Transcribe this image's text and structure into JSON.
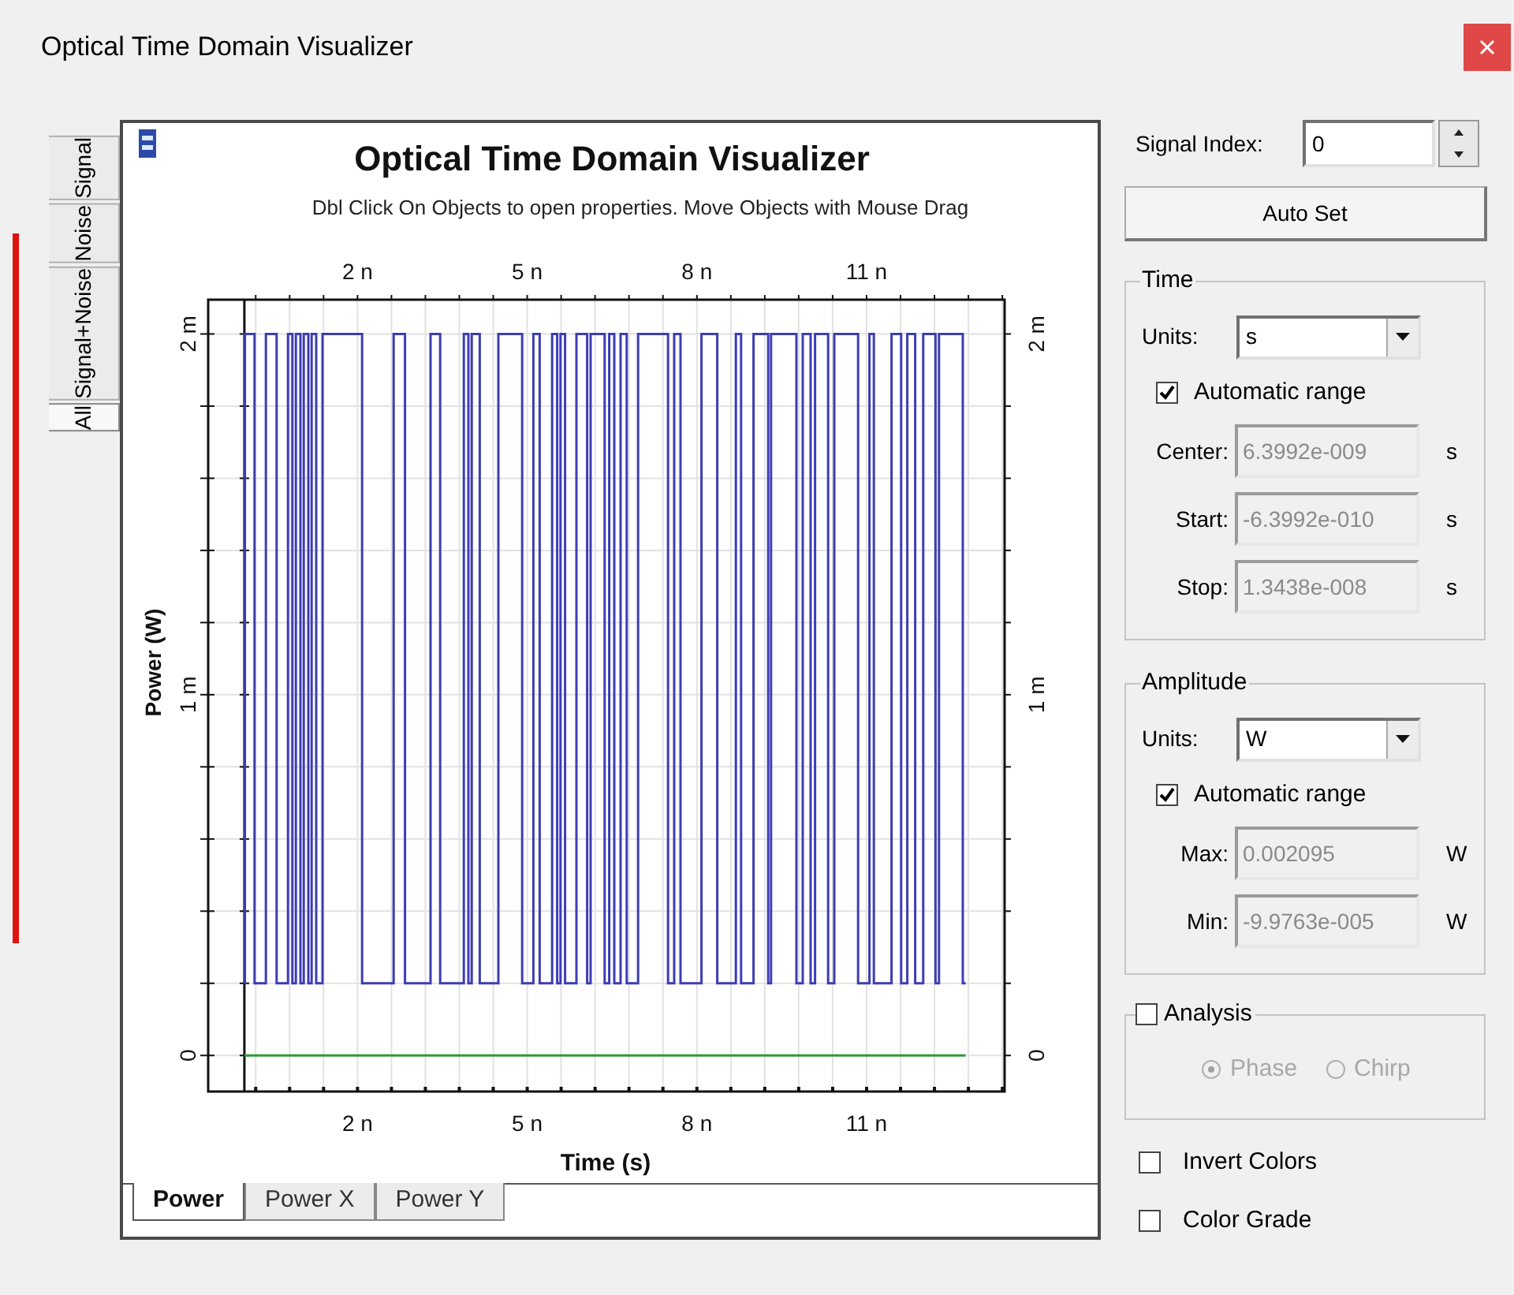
{
  "window": {
    "title": "Optical Time Domain Visualizer"
  },
  "side_tabs": [
    {
      "label": "Signal",
      "selected": false
    },
    {
      "label": "Noise",
      "selected": false
    },
    {
      "label": "Signal+Noise",
      "selected": false
    },
    {
      "label": "All",
      "selected": true
    }
  ],
  "plot": {
    "hint": "Dbl Click On Objects to open properties.  Move Objects with Mouse Drag",
    "top_xtick_labels": [
      "2 n",
      "5 n",
      "8 n",
      "11 n"
    ],
    "right_ytick_labels": [
      "2 m",
      "1 m",
      "0"
    ],
    "chart_data": {
      "type": "line",
      "grid": true,
      "title": "Optical Time Domain Visualizer",
      "xlabel": "Time (s)",
      "ylabel": "Power (W)",
      "xlim": [
        -0.64,
        13.44
      ],
      "ylim": [
        -0.1,
        2.095
      ],
      "xticks": [
        {
          "value": 2,
          "label": "2 n"
        },
        {
          "value": 5,
          "label": "5 n"
        },
        {
          "value": 8,
          "label": "8 n"
        },
        {
          "value": 11,
          "label": "11 n"
        }
      ],
      "yticks": [
        {
          "value": 2,
          "label": "2 m"
        },
        {
          "value": 1,
          "label": "1 m"
        },
        {
          "value": 0,
          "label": "0"
        }
      ],
      "x": [
        0,
        0.01,
        0.01,
        0.18,
        0.18,
        0.38,
        0.38,
        0.57,
        0.57,
        0.77,
        0.77,
        0.85,
        0.85,
        0.91,
        0.91,
        0.99,
        0.99,
        1.05,
        1.05,
        1.13,
        1.13,
        1.19,
        1.19,
        1.27,
        1.27,
        1.38,
        1.38,
        2.08,
        2.08,
        2.64,
        2.64,
        2.84,
        2.84,
        3.29,
        3.29,
        3.46,
        3.46,
        3.88,
        3.88,
        3.96,
        3.96,
        4.02,
        4.02,
        4.16,
        4.16,
        4.49,
        4.49,
        4.91,
        4.91,
        5.11,
        5.11,
        5.22,
        5.22,
        5.44,
        5.44,
        5.53,
        5.53,
        5.59,
        5.59,
        5.67,
        5.67,
        5.87,
        5.87,
        6.06,
        6.06,
        6.12,
        6.12,
        6.37,
        6.37,
        6.45,
        6.45,
        6.54,
        6.54,
        6.65,
        6.65,
        6.76,
        6.76,
        6.96,
        6.96,
        7.49,
        7.49,
        7.6,
        7.6,
        7.71,
        7.71,
        8.08,
        8.08,
        8.36,
        8.36,
        8.69,
        8.69,
        8.78,
        8.78,
        9.0,
        9.0,
        9.26,
        9.26,
        9.31,
        9.31,
        9.76,
        9.76,
        9.87,
        9.87,
        10.01,
        10.01,
        10.09,
        10.09,
        10.32,
        10.32,
        10.43,
        10.43,
        10.85,
        10.85,
        11.05,
        11.05,
        11.13,
        11.13,
        11.44,
        11.44,
        11.61,
        11.61,
        11.72,
        11.72,
        11.86,
        11.86,
        12.0,
        12.0,
        12.22,
        12.22,
        12.28,
        12.28,
        12.7,
        12.7,
        12.75
      ],
      "series": [
        {
          "color": "#3d3db4",
          "values": [
            0.2,
            0.2,
            2,
            2,
            0.2,
            0.2,
            2,
            2,
            0.2,
            0.2,
            2,
            2,
            0.2,
            0.2,
            2,
            2,
            0.2,
            0.2,
            2,
            2,
            0.2,
            0.2,
            2,
            2,
            0.2,
            0.2,
            2,
            2,
            0.2,
            0.2,
            2,
            2,
            0.2,
            0.2,
            2,
            2,
            0.2,
            0.2,
            2,
            2,
            0.2,
            0.2,
            2,
            2,
            0.2,
            0.2,
            2,
            2,
            0.2,
            0.2,
            2,
            2,
            0.2,
            0.2,
            2,
            2,
            0.2,
            0.2,
            2,
            2,
            0.2,
            0.2,
            2,
            2,
            0.2,
            0.2,
            2,
            2,
            0.2,
            0.2,
            2,
            2,
            0.2,
            0.2,
            2,
            2,
            0.2,
            0.2,
            2,
            2,
            0.2,
            0.2,
            2,
            2,
            0.2,
            0.2,
            2,
            2,
            0.2,
            0.2,
            2,
            2,
            0.2,
            0.2,
            2,
            2,
            0.2,
            0.2,
            2,
            2,
            0.2,
            0.2,
            2,
            2,
            0.2,
            0.2,
            2,
            2,
            0.2,
            0.2,
            2,
            2,
            0.2,
            0.2,
            2,
            2,
            0.2,
            0.2,
            2,
            2,
            0.2,
            0.2,
            2,
            2,
            0.2,
            0.2,
            2,
            2,
            0.2,
            0.2,
            2,
            2,
            0.2,
            0.2
          ]
        },
        {
          "color": "#2f9a3a",
          "values": [
            0,
            0,
            0,
            0,
            0,
            0,
            0,
            0,
            0,
            0,
            0,
            0,
            0,
            0,
            0,
            0,
            0,
            0,
            0,
            0,
            0,
            0,
            0,
            0,
            0,
            0,
            0,
            0,
            0,
            0,
            0,
            0,
            0,
            0,
            0,
            0,
            0,
            0,
            0,
            0,
            0,
            0,
            0,
            0,
            0,
            0,
            0,
            0,
            0,
            0,
            0,
            0,
            0,
            0,
            0,
            0,
            0,
            0,
            0,
            0,
            0,
            0,
            0,
            0,
            0,
            0,
            0,
            0,
            0,
            0,
            0,
            0,
            0,
            0,
            0,
            0,
            0,
            0,
            0,
            0,
            0,
            0,
            0,
            0,
            0,
            0,
            0,
            0,
            0,
            0,
            0,
            0,
            0,
            0,
            0,
            0,
            0,
            0,
            0,
            0,
            0,
            0,
            0,
            0,
            0,
            0,
            0,
            0,
            0,
            0,
            0,
            0,
            0,
            0,
            0,
            0,
            0,
            0,
            0,
            0,
            0,
            0,
            0,
            0,
            0,
            0,
            0,
            0,
            0,
            0,
            0,
            0,
            0,
            0
          ]
        }
      ]
    }
  },
  "plot_tabs": [
    {
      "label": "Power",
      "selected": true
    },
    {
      "label": "Power X",
      "selected": false
    },
    {
      "label": "Power Y",
      "selected": false
    }
  ],
  "signal_index": {
    "label": "Signal Index:",
    "value": "0"
  },
  "auto_set_button": "Auto Set",
  "groups": [
    {
      "title": "Time",
      "units_label": "Units:",
      "units": "s",
      "automatic_range": {
        "label": "Automatic range",
        "checked": true
      },
      "fields": [
        {
          "label": "Center:",
          "value": "6.3992e-009",
          "unit": "s",
          "disabled": true
        },
        {
          "label": "Start:",
          "value": "-6.3992e-010",
          "unit": "s",
          "disabled": true
        },
        {
          "label": "Stop:",
          "value": "1.3438e-008",
          "unit": "s",
          "disabled": true
        }
      ]
    },
    {
      "title": "Amplitude",
      "units_label": "Units:",
      "units": "W",
      "automatic_range": {
        "label": "Automatic range",
        "checked": true
      },
      "fields": [
        {
          "label": "Max:",
          "value": "0.002095",
          "unit": "W",
          "disabled": true
        },
        {
          "label": "Min:",
          "value": "-9.9763e-005",
          "unit": "W",
          "disabled": true
        }
      ]
    }
  ],
  "analysis": {
    "title": "Analysis",
    "checked": false,
    "options": [
      {
        "label": "Phase",
        "selected": true,
        "disabled": true
      },
      {
        "label": "Chirp",
        "selected": false,
        "disabled": true
      }
    ]
  },
  "options": [
    {
      "label": "Invert Colors",
      "checked": false
    },
    {
      "label": "Color Grade",
      "checked": false
    }
  ]
}
